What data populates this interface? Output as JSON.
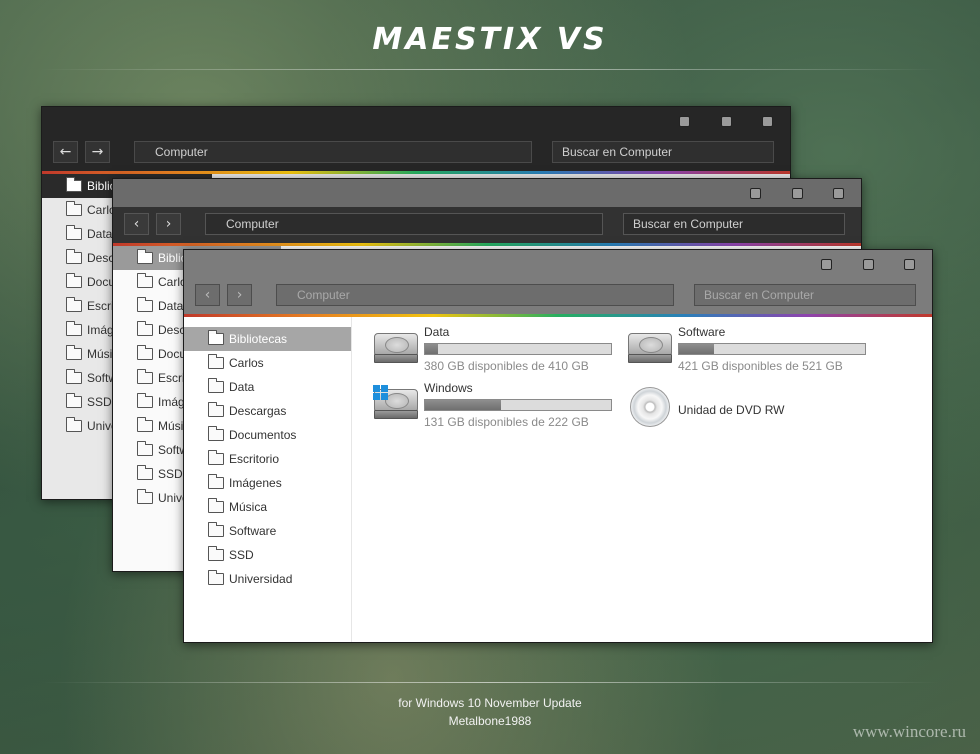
{
  "page": {
    "title": "MAESTIX VS",
    "footer_line1": "for Windows 10 November Update",
    "footer_line2": "Metalbone1988",
    "watermark": "www.wincore.ru"
  },
  "explorer": {
    "address": "Computer",
    "search_placeholder": "Buscar en Computer",
    "back_icon": "arrow-left-icon",
    "forward_icon": "arrow-right-icon",
    "sidebar": [
      {
        "label": "Bibliotecas",
        "selected": true
      },
      {
        "label": "Carlos"
      },
      {
        "label": "Data"
      },
      {
        "label": "Descargas"
      },
      {
        "label": "Documentos"
      },
      {
        "label": "Escritorio"
      },
      {
        "label": "Imágenes"
      },
      {
        "label": "Música"
      },
      {
        "label": "Software"
      },
      {
        "label": "SSD"
      },
      {
        "label": "Universidad"
      }
    ],
    "drives": [
      {
        "name": "Data",
        "free": "380 GB disponibles de 410 GB",
        "used_fraction": 0.07,
        "icon": "hard-drive-icon"
      },
      {
        "name": "Software",
        "free": "421 GB disponibles de 521 GB",
        "used_fraction": 0.19,
        "icon": "hard-drive-icon"
      },
      {
        "name": "Windows",
        "free": "131 GB disponibles de 222 GB",
        "used_fraction": 0.41,
        "icon": "windows-drive-icon"
      },
      {
        "name": "Unidad de DVD RW",
        "icon": "dvd-icon"
      }
    ]
  },
  "colors": {
    "theme_dark": "#262626",
    "theme_gray": "#7c7c7c",
    "selection": "#a6a6a6"
  }
}
